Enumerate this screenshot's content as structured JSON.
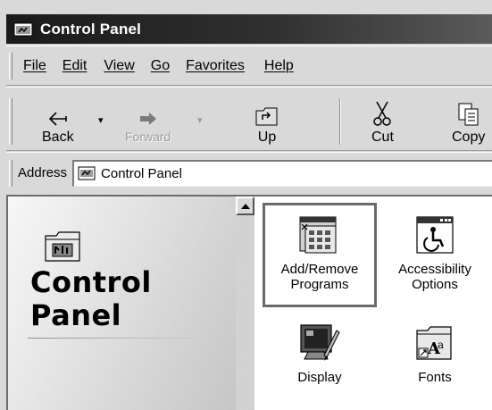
{
  "window": {
    "title": "Control Panel"
  },
  "menu": {
    "items": [
      "File",
      "Edit",
      "View",
      "Go",
      "Favorites",
      "Help"
    ]
  },
  "toolbar": {
    "back_label": "Back",
    "forward_label": "Forward",
    "up_label": "Up",
    "cut_label": "Cut",
    "copy_label": "Copy"
  },
  "address": {
    "label": "Address",
    "value": "Control Panel"
  },
  "left_panel": {
    "title_line1": "Control",
    "title_line2": "Panel"
  },
  "items": [
    {
      "label": "Add/Remove\nPrograms",
      "icon": "add-remove-programs-icon",
      "selected": true
    },
    {
      "label": "Accessibility\nOptions",
      "icon": "accessibility-icon",
      "selected": false
    },
    {
      "label": "Display",
      "icon": "display-icon",
      "selected": false
    },
    {
      "label": "Fonts",
      "icon": "fonts-folder-icon",
      "selected": false
    }
  ],
  "colors": {
    "titlebar": "#1a1a1a",
    "window_bg": "#d9d9d9",
    "selection_border": "#6a6a6a"
  }
}
